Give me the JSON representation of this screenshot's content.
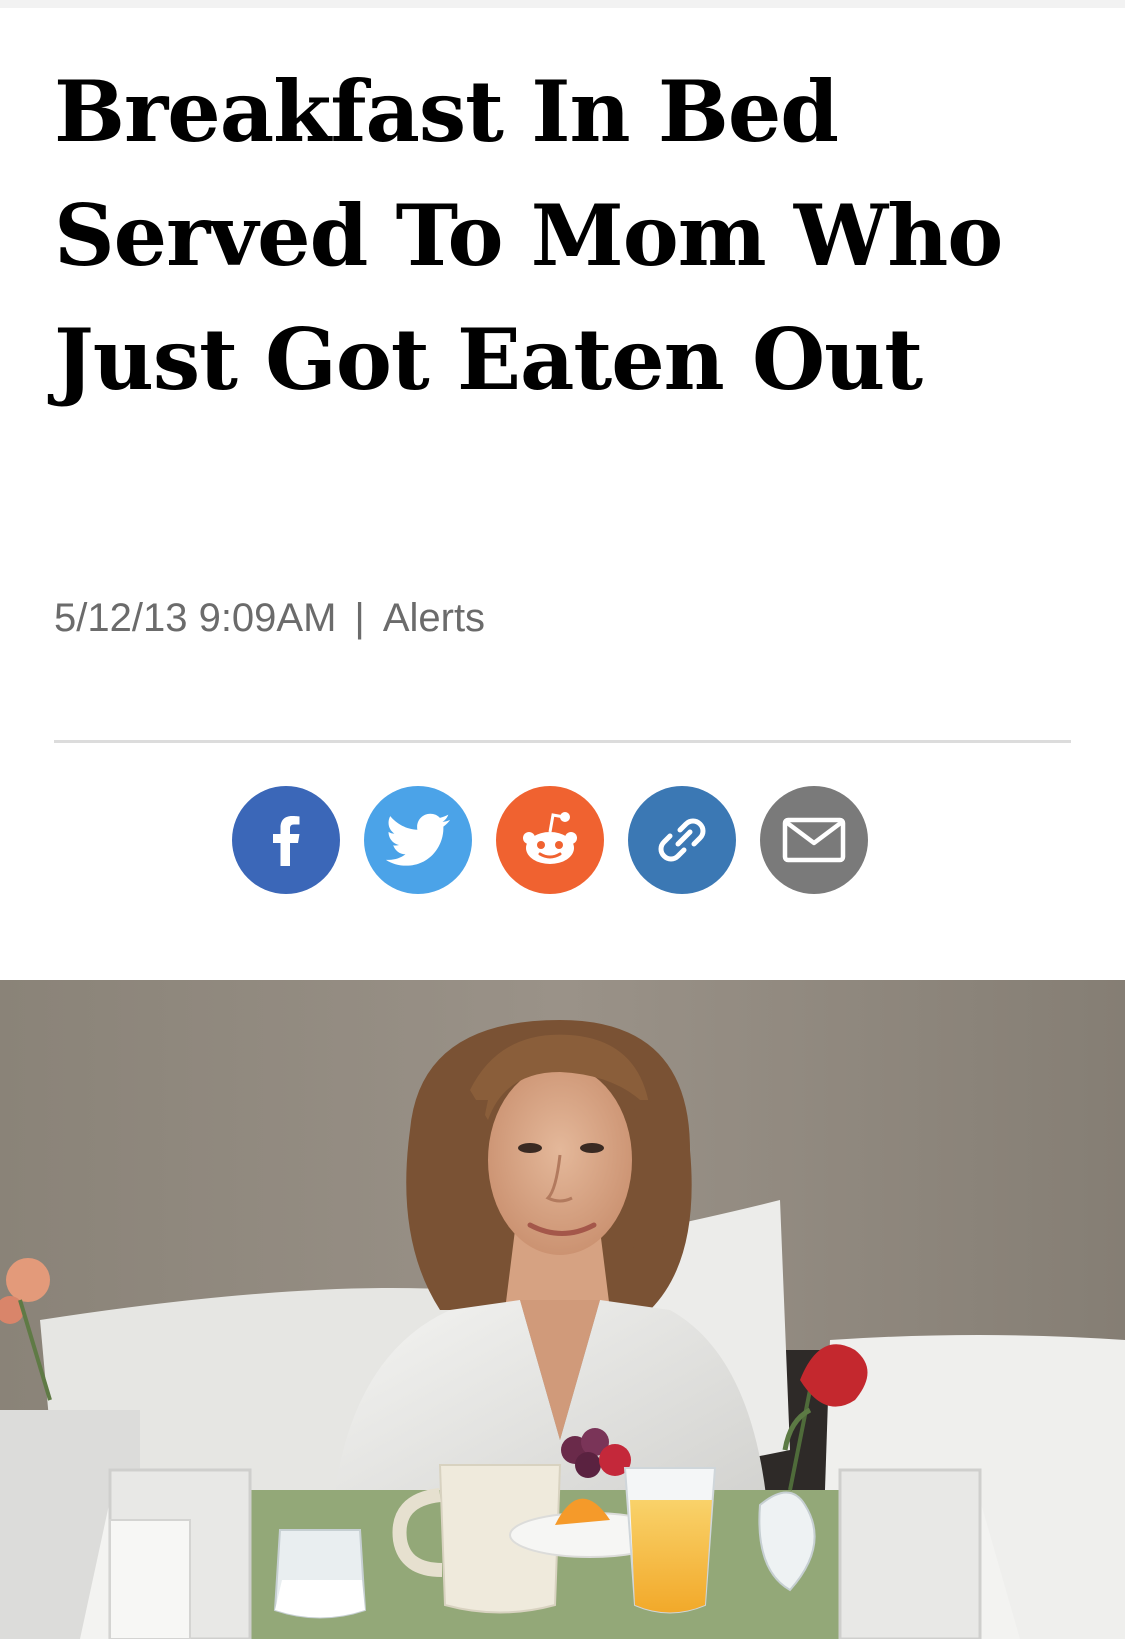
{
  "article": {
    "headline": "Breakfast In Bed Served To Mom Who Just Got Eaten Out",
    "date": "5/12/13 9:09AM",
    "separator": "|",
    "category": "Alerts"
  },
  "share": {
    "buttons": [
      {
        "name": "facebook",
        "icon": "facebook-icon",
        "color": "#3b67b8"
      },
      {
        "name": "twitter",
        "icon": "twitter-icon",
        "color": "#4ba3e8"
      },
      {
        "name": "reddit",
        "icon": "reddit-icon",
        "color": "#f06230"
      },
      {
        "name": "copy-link",
        "icon": "link-icon",
        "color": "#3b78b4"
      },
      {
        "name": "email",
        "icon": "mail-icon",
        "color": "#7a7a7a"
      }
    ]
  },
  "colors": {
    "headline": "#000000",
    "meta": "#6b6b6b",
    "divider": "#dcdcdc"
  }
}
